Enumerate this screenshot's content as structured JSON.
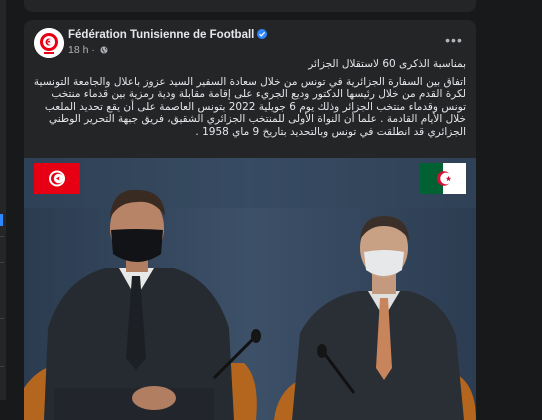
{
  "post": {
    "page_name": "Fédération Tunisienne de Football",
    "timestamp": "18 h",
    "separator": "·",
    "text_line1": "بمناسبة الذكرى 60 لاستقلال الجزائر",
    "text_body": "اتفاق بين السفارة الجزائرية في تونس من خلال سعادة السفير السيد عزوز باعلال والجامعة التونسية لكرة القدم من خلال رئيسها الدكتور وديع الجريء على إقامة مقابلة ودية رمزية بين قدماء منتخب تونس وقدماء منتخب الجزائر وذلك يوم 6 جويلية 2022 بتونس العاصمة على أن يقع تحديد الملعب خلال الأيام القادمة . علما أن النواة الأولى للمنتخب الجزائري الشقيق، فريق جبهة التحرير الوطني الجزائري قد انطلقت في تونس وبالتحديد بتاريخ 9 ماي 1958 .",
    "more_icon": "more-horizontal-icon",
    "verified_icon": "verified-badge-icon",
    "globe_icon": "globe-icon"
  },
  "colors": {
    "background": "#18191a",
    "card": "#242526",
    "text_primary": "#e4e6eb",
    "text_secondary": "#b0b3b8",
    "accent": "#2d88ff",
    "tunisia_red": "#e70013",
    "algeria_green": "#006233"
  }
}
